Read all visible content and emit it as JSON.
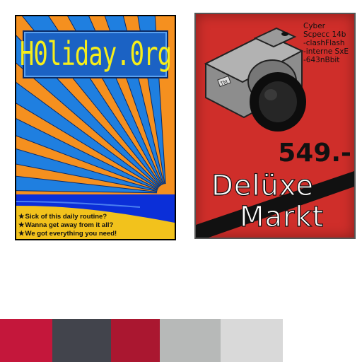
{
  "holiday_poster": {
    "title": "H0liday.0rg",
    "slogans": [
      "Sick of this daily routine?",
      "Wanna get away from it all?",
      "We got everything you need!"
    ],
    "bullet": "★",
    "colors": {
      "sky": "#f5901f",
      "rays": "#1f7fe0",
      "sea": "#0b2fd8",
      "sand": "#f2c21c",
      "title_text": "#f6ee1a",
      "title_box": "#1b62c4"
    }
  },
  "camera_poster": {
    "specs": [
      "Cyber",
      "Scpecc 14b",
      "-clashFlash",
      "-interne SxE",
      "-643nBbit"
    ],
    "camera_badge": "TM",
    "price": "549.-",
    "brand_line1": "Delüxe",
    "brand_line2": "Markt",
    "colors": {
      "background": "#cf2e2a",
      "camera_body": "#8d8d8d",
      "lens": "#0d0d0d"
    }
  },
  "palette": [
    {
      "name": "crimson",
      "color": "#c4173b"
    },
    {
      "name": "charcoal",
      "color": "#42444c"
    },
    {
      "name": "dark-red",
      "color": "#aa1730"
    },
    {
      "name": "silver",
      "color": "#b7b9b8"
    },
    {
      "name": "light-gray",
      "color": "#d9d9d9"
    }
  ]
}
